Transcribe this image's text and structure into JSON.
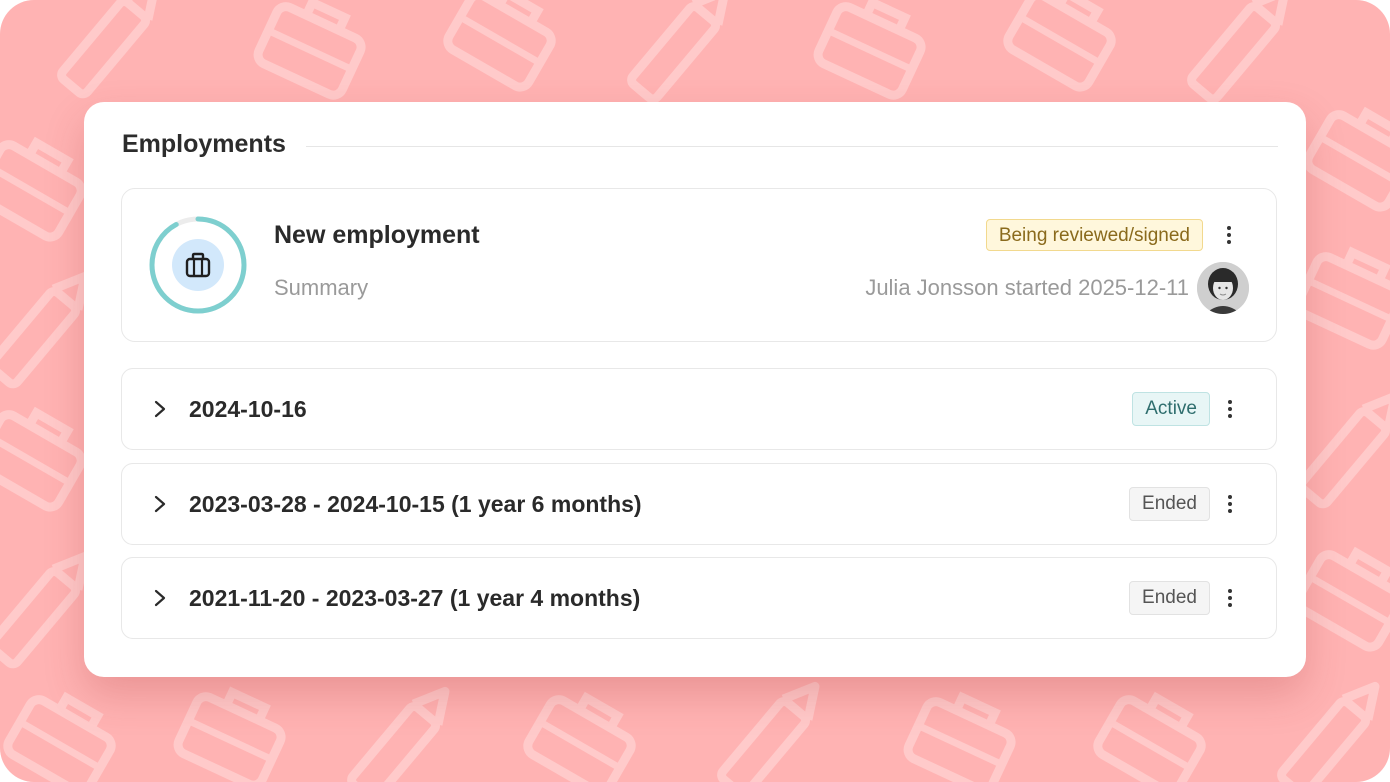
{
  "section": {
    "title": "Employments"
  },
  "new_employment": {
    "title": "New employment",
    "subtitle": "Summary",
    "status": "Being reviewed/signed",
    "started_text": "Julia Jonsson started 2025-12-11",
    "progress": 0.92
  },
  "employments": [
    {
      "title": "2024-10-16",
      "status": "Active"
    },
    {
      "title": "2023-03-28 - 2024-10-15 (1 year 6 months)",
      "status": "Ended"
    },
    {
      "title": "2021-11-20 - 2023-03-27 (1 year 4 months)",
      "status": "Ended"
    }
  ],
  "colors": {
    "background": "#ffb3b3",
    "ring": "#7ecfcf",
    "ring_track": "#ececec",
    "bag_circle": "#d2e8fb",
    "badge_review_bg": "#fff7dc",
    "badge_active_bg": "#e8f6f6",
    "badge_ended_bg": "#f5f5f5"
  },
  "icons": {
    "ring": "progress-ring-icon",
    "bag": "briefcase-icon",
    "more": "kebab-menu-icon",
    "expand": "chevron-right-icon",
    "avatar": "user-avatar"
  }
}
